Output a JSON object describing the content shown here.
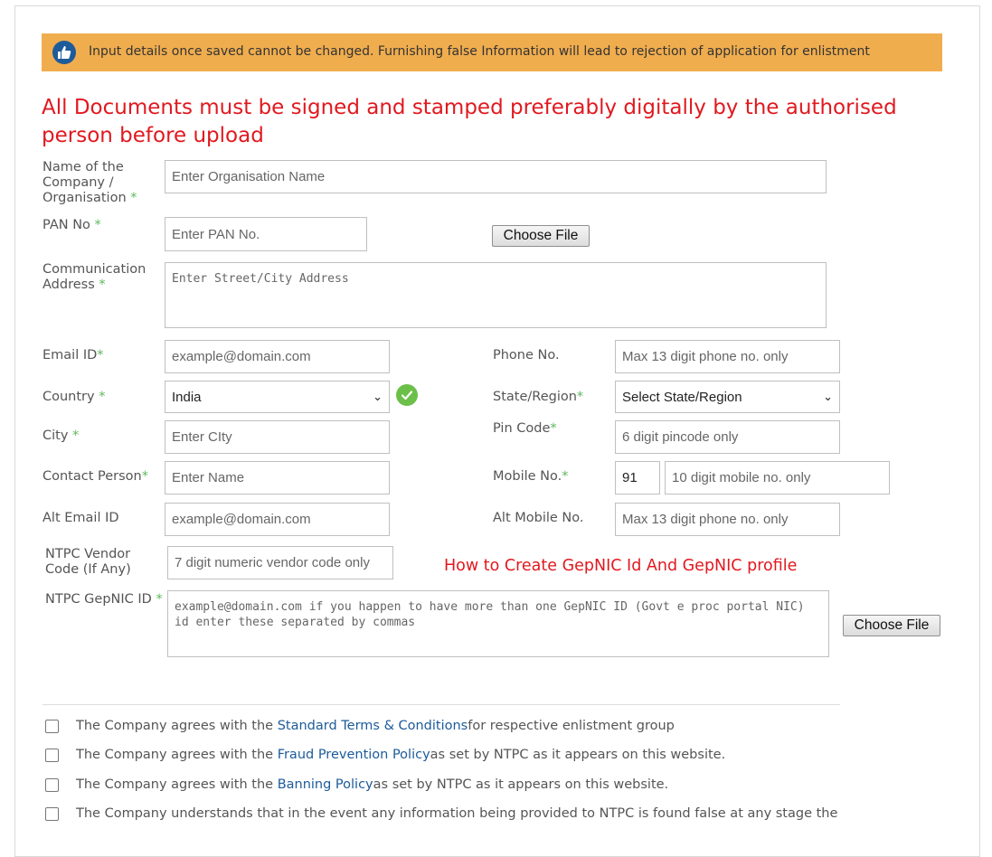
{
  "banner": {
    "text": "Input details once saved cannot be changed. Furnishing false Information will lead to rejection of application for enlistment",
    "icon": "thumbs-up-icon"
  },
  "notice": "All Documents must be signed and stamped preferably digitally by the authorised person before upload",
  "required_mark": "*",
  "fields": {
    "org_name": {
      "label1": "Name of the",
      "label2": "Company /",
      "label3": "Organisation",
      "placeholder": "Enter Organisation Name"
    },
    "pan": {
      "label": "PAN No",
      "placeholder": "Enter PAN No."
    },
    "address": {
      "label1": "Communication",
      "label2": "Address",
      "placeholder": "Enter Street/City Address"
    },
    "email": {
      "label": "Email ID",
      "placeholder": "example@domain.com"
    },
    "phone": {
      "label": "Phone No.",
      "placeholder": "Max 13 digit phone no. only"
    },
    "country": {
      "label": "Country",
      "value": "India"
    },
    "state": {
      "label": "State/Region",
      "value": "Select State/Region"
    },
    "city": {
      "label": "City",
      "placeholder": "Enter CIty"
    },
    "pincode": {
      "label": "Pin Code",
      "placeholder": "6 digit pincode only"
    },
    "contact": {
      "label": "Contact Person",
      "placeholder": "Enter Name"
    },
    "mobile": {
      "label": "Mobile No.",
      "code": "91",
      "placeholder": "10 digit mobile no. only"
    },
    "alt_email": {
      "label": "Alt Email ID",
      "placeholder": "example@domain.com"
    },
    "alt_mobile": {
      "label": "Alt Mobile No.",
      "placeholder": "Max 13 digit phone no. only"
    },
    "vendor": {
      "label1": "NTPC Vendor",
      "label2": "Code (If Any)",
      "placeholder": "7 digit numeric vendor code only"
    },
    "gepnic": {
      "label": "NTPC GepNIC ID",
      "placeholder": "example@domain.com if you happen to have more than one GepNIC ID (Govt e proc portal NIC) id enter these separated by commas"
    }
  },
  "choose_file": "Choose File",
  "gepnic_help_link": "How to Create GepNIC Id And GepNIC profile",
  "agreements": [
    {
      "pre": "The Company agrees with the ",
      "link": "Standard Terms & Conditions",
      "post": " for respective enlistment group"
    },
    {
      "pre": "The Company agrees with the ",
      "link": "Fraud Prevention Policy",
      "post": " as set by NTPC as it appears on this website."
    },
    {
      "pre": "The Company agrees with the ",
      "link": "Banning Policy",
      "post": " as set by NTPC as it appears on this website."
    },
    {
      "pre": "The Company understands that in the event any information being provided to NTPC is found false at any stage the",
      "link": "",
      "post": ""
    }
  ],
  "colors": {
    "banner": "#f0ad4e",
    "notice": "#e0191f",
    "required": "#5cb85c",
    "link": "#1d5b9a"
  }
}
